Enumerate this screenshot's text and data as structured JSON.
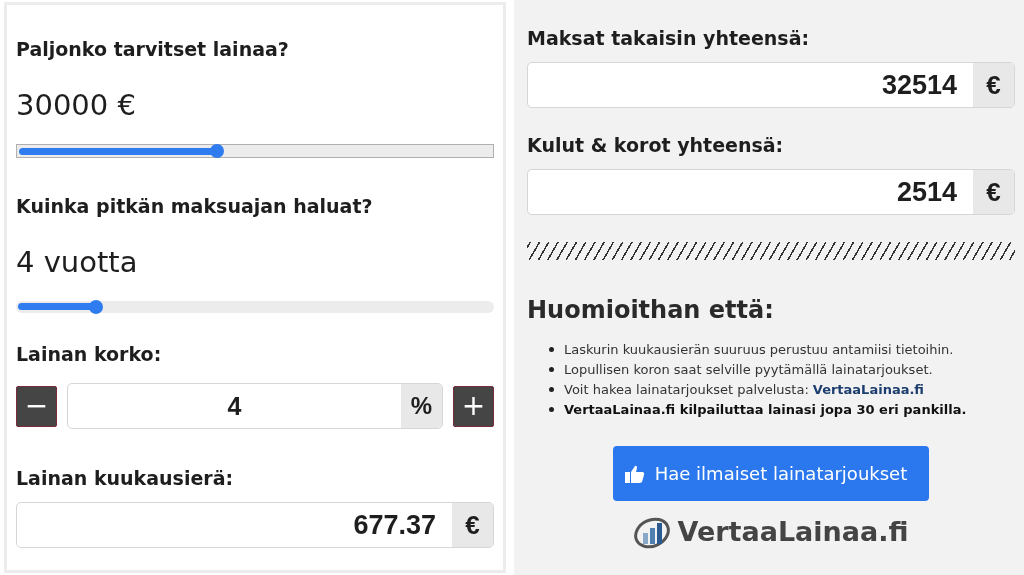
{
  "calculator": {
    "amount": {
      "label": "Paljonko tarvitset lainaa?",
      "value": "30000 €",
      "level": 0.42,
      "focused": true
    },
    "term": {
      "label": "Kuinka pitkän maksuajan haluat?",
      "value": "4 vuotta",
      "level": 0.167,
      "focused": false
    },
    "interest": {
      "label": "Lainan korko:",
      "minus": "−",
      "value": "4",
      "unit": "%",
      "plus": "+"
    },
    "monthly": {
      "label": "Lainan kuukausierä:",
      "value": "677.37",
      "unit": "€"
    }
  },
  "results": [
    {
      "label": "Maksat takaisin yhteensä:",
      "value": "32514",
      "unit": "€"
    },
    {
      "label": "Kulut & korot yhteensä:",
      "value": "2514",
      "unit": "€"
    }
  ],
  "notes": {
    "title": "Huomioithan että:",
    "items": [
      {
        "kind": "plain",
        "text": "Laskurin kuukausierän suuruus perustuu antamiisi tietoihin."
      },
      {
        "kind": "plain",
        "text": "Lopullisen koron saat selville pyytämällä lainatarjoukset."
      },
      {
        "kind": "link",
        "text": "Voit hakea lainatarjoukset palvelusta:",
        "link": "VertaaLainaa.fi"
      },
      {
        "kind": "bold",
        "text": "VertaaLainaa.fi kilpailuttaa lainasi jopa 30 eri pankilla."
      }
    ]
  },
  "cta_button": "Hae ilmaiset lainatarjoukset",
  "logo": "VertaaLainaa.fi"
}
